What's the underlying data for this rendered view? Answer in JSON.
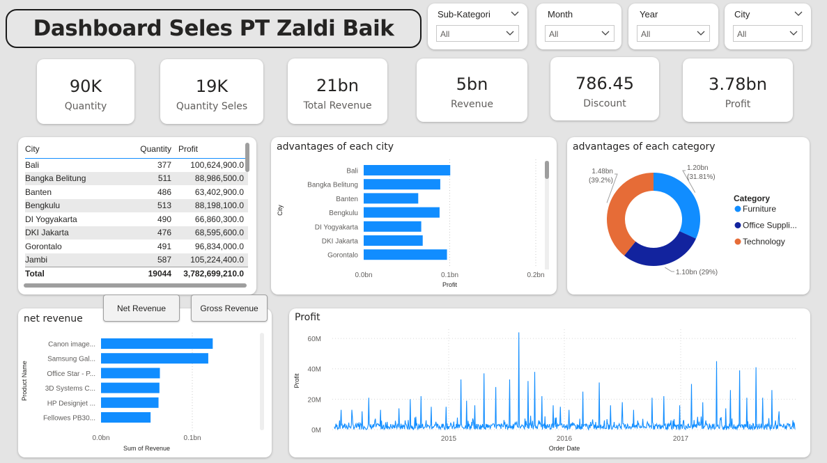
{
  "title": "Dashboard Seles PT Zaldi Baik",
  "slicers": [
    {
      "title": "Sub-Kategori",
      "value": "All"
    },
    {
      "title": "Month",
      "value": "All"
    },
    {
      "title": "Year",
      "value": "All"
    },
    {
      "title": "City",
      "value": "All"
    }
  ],
  "kpis": [
    {
      "value": "90K",
      "label": "Quantity"
    },
    {
      "value": "19K",
      "label": "Quantity Seles"
    },
    {
      "value": "21bn",
      "label": "Total Revenue"
    },
    {
      "value": "5bn",
      "label": "Revenue"
    },
    {
      "value": "786.45",
      "label": "Discount"
    },
    {
      "value": "3.78bn",
      "label": "Profit"
    }
  ],
  "table": {
    "headers": [
      "City",
      "Quantity",
      "Profit"
    ],
    "rows": [
      [
        "Bali",
        "377",
        "100,624,900.0"
      ],
      [
        "Bangka Belitung",
        "511",
        "88,986,500.0"
      ],
      [
        "Banten",
        "486",
        "63,402,900.0"
      ],
      [
        "Bengkulu",
        "513",
        "88,198,100.0"
      ],
      [
        "DI Yogyakarta",
        "490",
        "66,860,300.0"
      ],
      [
        "DKI Jakarta",
        "476",
        "68,595,600.0"
      ],
      [
        "Gorontalo",
        "491",
        "96,834,000.0"
      ],
      [
        "Jambi",
        "587",
        "105,224,400.0"
      ]
    ],
    "total": [
      "Total",
      "19044",
      "3,782,699,210.0"
    ]
  },
  "buttons": {
    "net": "Net Revenue",
    "gross": "Gross Revenue"
  },
  "charts": {
    "city": {
      "title": "advantages of each city",
      "chart_data": {
        "type": "bar",
        "orientation": "horizontal",
        "categories": [
          "Bali",
          "Bangka Belitung",
          "Banten",
          "Bengkulu",
          "DI Yogyakarta",
          "DKI Jakarta",
          "Gorontalo"
        ],
        "values": [
          0.1006,
          0.089,
          0.0634,
          0.0882,
          0.0669,
          0.0686,
          0.0968
        ],
        "xlabel": "Profit",
        "ylabel": "City",
        "xticks": [
          "0.0bn",
          "0.1bn",
          "0.2bn"
        ],
        "xlim": [
          0,
          0.2
        ]
      }
    },
    "category": {
      "title": "advantages of each category",
      "legend_title": "Category",
      "chart_data": {
        "type": "pie",
        "donut": true,
        "categories": [
          "Furniture",
          "Office Suppli...",
          "Technology"
        ],
        "values": [
          31.81,
          29.0,
          39.2
        ],
        "labels": [
          "1.20bn (31.81%)",
          "1.10bn (29%)",
          "1.48bn (39.2%)"
        ],
        "colors": [
          "#118dff",
          "#12239e",
          "#e66c37"
        ],
        "legend": "right"
      }
    },
    "net": {
      "title": "net revenue",
      "chart_data": {
        "type": "bar",
        "orientation": "horizontal",
        "categories": [
          "Canon image...",
          "Samsung Gal...",
          "Office Star - P...",
          "3D Systems C...",
          "HP Designjet ...",
          "Fellowes PB30..."
        ],
        "values": [
          0.1224,
          0.1175,
          0.0645,
          0.064,
          0.063,
          0.0543
        ],
        "xlabel": "Sum of Revenue",
        "ylabel": "Product Name",
        "xticks": [
          "0.0bn",
          "0.1bn"
        ],
        "xlim": [
          0,
          0.2
        ]
      }
    },
    "profit": {
      "title": "Profit",
      "chart_data": {
        "type": "line",
        "xlabel": "Order Date",
        "ylabel": "Profit",
        "yticks": [
          "0M",
          "20M",
          "40M",
          "60M"
        ],
        "ylim": [
          0,
          66
        ],
        "xticks": [
          "2015",
          "2016",
          "2017"
        ],
        "color": "#118dff",
        "spikes": [
          [
            0.03,
            13
          ],
          [
            0.075,
            13
          ],
          [
            0.12,
            12
          ],
          [
            0.15,
            21
          ],
          [
            0.2,
            13
          ],
          [
            0.28,
            14
          ],
          [
            0.33,
            20
          ],
          [
            0.375,
            22
          ],
          [
            0.42,
            15
          ],
          [
            0.485,
            15
          ],
          [
            0.55,
            33
          ],
          [
            0.575,
            19
          ],
          [
            0.61,
            16
          ],
          [
            0.65,
            37
          ],
          [
            0.7,
            28
          ],
          [
            0.76,
            33
          ],
          [
            0.8,
            64
          ],
          [
            0.84,
            32
          ],
          [
            0.87,
            38
          ],
          [
            0.9,
            22
          ],
          [
            0.95,
            16
          ],
          [
            0.98,
            15
          ],
          [
            1.02,
            13
          ],
          [
            1.08,
            25
          ],
          [
            1.15,
            31
          ],
          [
            1.2,
            16
          ],
          [
            1.25,
            18
          ],
          [
            1.3,
            13
          ],
          [
            1.38,
            21
          ],
          [
            1.43,
            22
          ],
          [
            1.5,
            16
          ],
          [
            1.55,
            30
          ],
          [
            1.6,
            18
          ],
          [
            1.66,
            45
          ],
          [
            1.7,
            14
          ],
          [
            1.72,
            26
          ],
          [
            1.76,
            39
          ],
          [
            1.79,
            21
          ],
          [
            1.83,
            41
          ],
          [
            1.86,
            21
          ],
          [
            1.9,
            26
          ],
          [
            1.93,
            12
          ]
        ]
      }
    }
  }
}
